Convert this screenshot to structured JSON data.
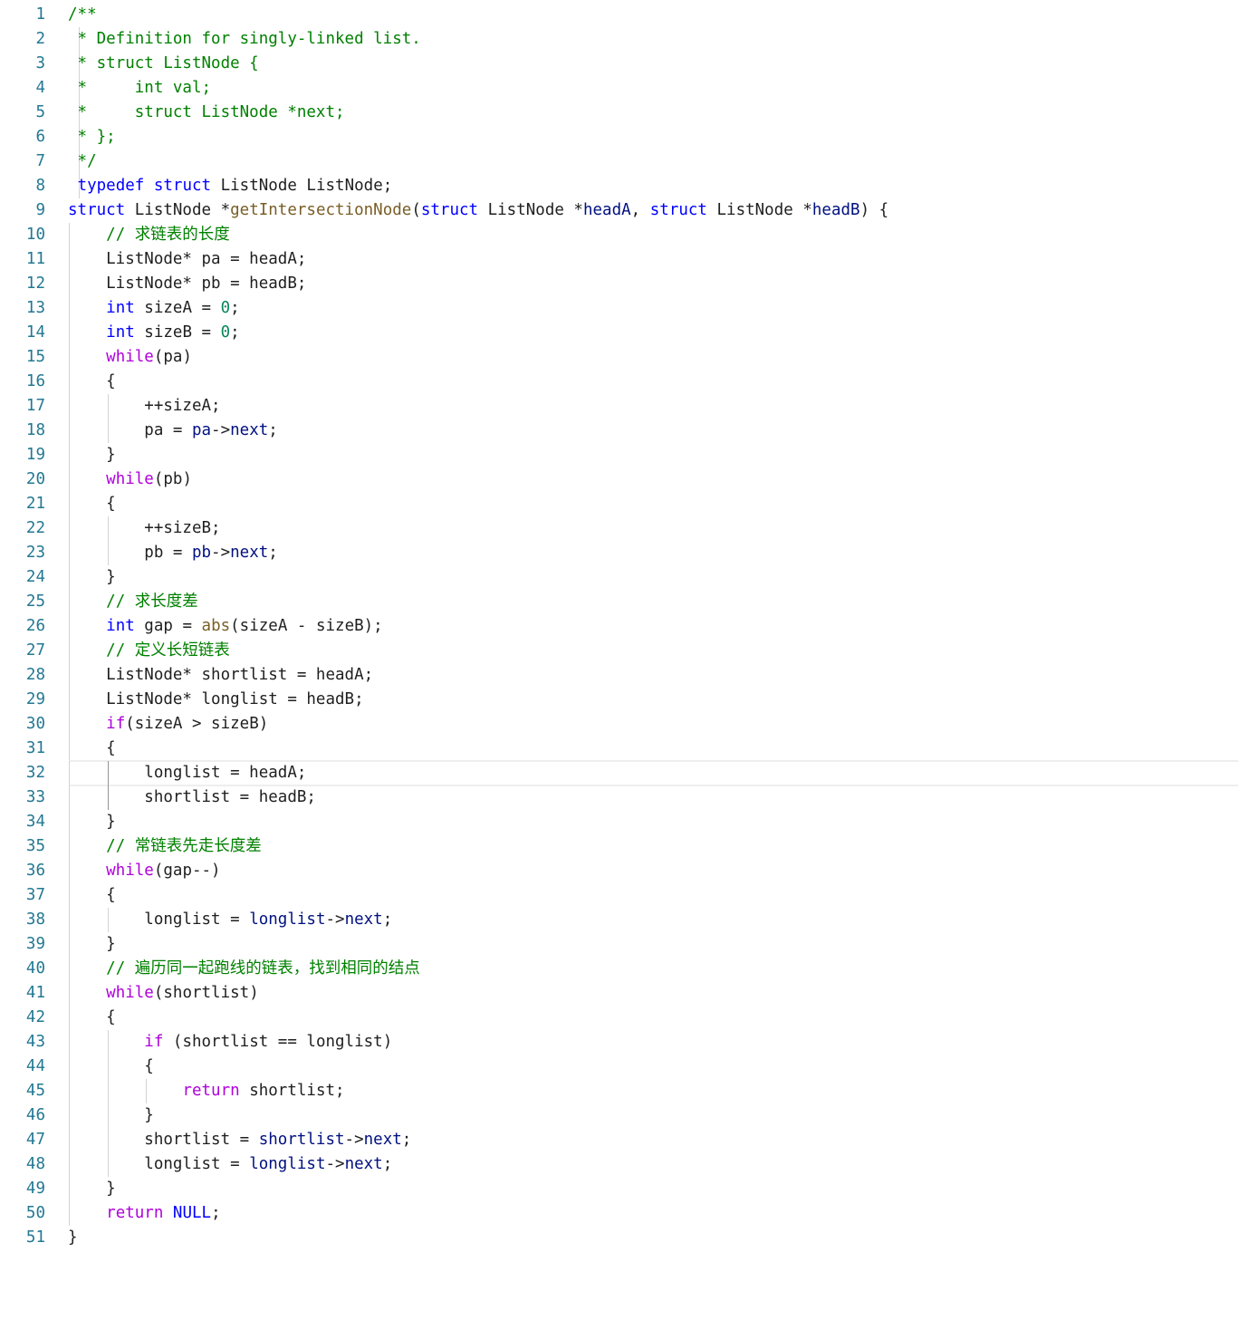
{
  "editor": {
    "language": "c",
    "current_line": 32,
    "lines": [
      {
        "n": "1",
        "tokens": [
          [
            "comment",
            "/**"
          ]
        ]
      },
      {
        "n": "2",
        "tokens": [
          [
            "comment",
            " * Definition for singly-linked list."
          ]
        ]
      },
      {
        "n": "3",
        "tokens": [
          [
            "comment",
            " * struct ListNode {"
          ]
        ]
      },
      {
        "n": "4",
        "tokens": [
          [
            "comment",
            " *     int val;"
          ]
        ]
      },
      {
        "n": "5",
        "tokens": [
          [
            "comment",
            " *     struct ListNode *next;"
          ]
        ]
      },
      {
        "n": "6",
        "tokens": [
          [
            "comment",
            " * };"
          ]
        ]
      },
      {
        "n": "7",
        "tokens": [
          [
            "comment",
            " */"
          ]
        ]
      },
      {
        "n": "8",
        "tokens": [
          [
            "text",
            " "
          ],
          [
            "keyword",
            "typedef"
          ],
          [
            "text",
            " "
          ],
          [
            "keyword",
            "struct"
          ],
          [
            "text",
            " ListNode ListNode;"
          ]
        ]
      },
      {
        "n": "9",
        "tokens": [
          [
            "keyword",
            "struct"
          ],
          [
            "text",
            " ListNode *"
          ],
          [
            "func",
            "getIntersectionNode"
          ],
          [
            "text",
            "("
          ],
          [
            "keyword",
            "struct"
          ],
          [
            "text",
            " ListNode *"
          ],
          [
            "var",
            "headA"
          ],
          [
            "text",
            ", "
          ],
          [
            "keyword",
            "struct"
          ],
          [
            "text",
            " ListNode *"
          ],
          [
            "var",
            "headB"
          ],
          [
            "text",
            ") {"
          ]
        ]
      },
      {
        "n": "10",
        "tokens": [
          [
            "text",
            "    "
          ],
          [
            "comment",
            "// "
          ],
          [
            "comment-cjk",
            "求链表的长度"
          ]
        ]
      },
      {
        "n": "11",
        "tokens": [
          [
            "text",
            "    ListNode* pa = headA;"
          ]
        ]
      },
      {
        "n": "12",
        "tokens": [
          [
            "text",
            "    ListNode* pb = headB;"
          ]
        ]
      },
      {
        "n": "13",
        "tokens": [
          [
            "text",
            "    "
          ],
          [
            "type",
            "int"
          ],
          [
            "text",
            " sizeA = "
          ],
          [
            "number",
            "0"
          ],
          [
            "text",
            ";"
          ]
        ]
      },
      {
        "n": "14",
        "tokens": [
          [
            "text",
            "    "
          ],
          [
            "type",
            "int"
          ],
          [
            "text",
            " sizeB = "
          ],
          [
            "number",
            "0"
          ],
          [
            "text",
            ";"
          ]
        ]
      },
      {
        "n": "15",
        "tokens": [
          [
            "text",
            "    "
          ],
          [
            "control",
            "while"
          ],
          [
            "text",
            "(pa)"
          ]
        ]
      },
      {
        "n": "16",
        "tokens": [
          [
            "text",
            "    {"
          ]
        ]
      },
      {
        "n": "17",
        "tokens": [
          [
            "text",
            "        ++sizeA;"
          ]
        ]
      },
      {
        "n": "18",
        "tokens": [
          [
            "text",
            "        pa = "
          ],
          [
            "var",
            "pa"
          ],
          [
            "text",
            "->"
          ],
          [
            "var",
            "next"
          ],
          [
            "text",
            ";"
          ]
        ]
      },
      {
        "n": "19",
        "tokens": [
          [
            "text",
            "    }"
          ]
        ]
      },
      {
        "n": "20",
        "tokens": [
          [
            "text",
            "    "
          ],
          [
            "control",
            "while"
          ],
          [
            "text",
            "(pb)"
          ]
        ]
      },
      {
        "n": "21",
        "tokens": [
          [
            "text",
            "    {"
          ]
        ]
      },
      {
        "n": "22",
        "tokens": [
          [
            "text",
            "        ++sizeB;"
          ]
        ]
      },
      {
        "n": "23",
        "tokens": [
          [
            "text",
            "        pb = "
          ],
          [
            "var",
            "pb"
          ],
          [
            "text",
            "->"
          ],
          [
            "var",
            "next"
          ],
          [
            "text",
            ";"
          ]
        ]
      },
      {
        "n": "24",
        "tokens": [
          [
            "text",
            "    }"
          ]
        ]
      },
      {
        "n": "25",
        "tokens": [
          [
            "text",
            "    "
          ],
          [
            "comment",
            "// "
          ],
          [
            "comment-cjk",
            "求长度差"
          ]
        ]
      },
      {
        "n": "26",
        "tokens": [
          [
            "text",
            "    "
          ],
          [
            "type",
            "int"
          ],
          [
            "text",
            " gap = "
          ],
          [
            "func",
            "abs"
          ],
          [
            "text",
            "(sizeA - sizeB);"
          ]
        ]
      },
      {
        "n": "27",
        "tokens": [
          [
            "text",
            "    "
          ],
          [
            "comment",
            "// "
          ],
          [
            "comment-cjk",
            "定义长短链表"
          ]
        ]
      },
      {
        "n": "28",
        "tokens": [
          [
            "text",
            "    ListNode* shortlist = headA;"
          ]
        ]
      },
      {
        "n": "29",
        "tokens": [
          [
            "text",
            "    ListNode* longlist = headB;"
          ]
        ]
      },
      {
        "n": "30",
        "tokens": [
          [
            "text",
            "    "
          ],
          [
            "control",
            "if"
          ],
          [
            "text",
            "(sizeA > sizeB)"
          ]
        ]
      },
      {
        "n": "31",
        "tokens": [
          [
            "text",
            "    {"
          ]
        ]
      },
      {
        "n": "32",
        "tokens": [
          [
            "text",
            "        longlist = headA;"
          ]
        ]
      },
      {
        "n": "33",
        "tokens": [
          [
            "text",
            "        shortlist = headB;"
          ]
        ]
      },
      {
        "n": "34",
        "tokens": [
          [
            "text",
            "    }"
          ]
        ]
      },
      {
        "n": "35",
        "tokens": [
          [
            "text",
            "    "
          ],
          [
            "comment",
            "// "
          ],
          [
            "comment-cjk",
            "常链表先走长度差"
          ]
        ]
      },
      {
        "n": "36",
        "tokens": [
          [
            "text",
            "    "
          ],
          [
            "control",
            "while"
          ],
          [
            "text",
            "(gap--)"
          ]
        ]
      },
      {
        "n": "37",
        "tokens": [
          [
            "text",
            "    {"
          ]
        ]
      },
      {
        "n": "38",
        "tokens": [
          [
            "text",
            "        longlist = "
          ],
          [
            "var",
            "longlist"
          ],
          [
            "text",
            "->"
          ],
          [
            "var",
            "next"
          ],
          [
            "text",
            ";"
          ]
        ]
      },
      {
        "n": "39",
        "tokens": [
          [
            "text",
            "    }"
          ]
        ]
      },
      {
        "n": "40",
        "tokens": [
          [
            "text",
            "    "
          ],
          [
            "comment",
            "// "
          ],
          [
            "comment-cjk",
            "遍历同一起跑线的链表，找到相同的结点"
          ]
        ]
      },
      {
        "n": "41",
        "tokens": [
          [
            "text",
            "    "
          ],
          [
            "control",
            "while"
          ],
          [
            "text",
            "(shortlist)"
          ]
        ]
      },
      {
        "n": "42",
        "tokens": [
          [
            "text",
            "    {"
          ]
        ]
      },
      {
        "n": "43",
        "tokens": [
          [
            "text",
            "        "
          ],
          [
            "control",
            "if"
          ],
          [
            "text",
            " (shortlist == longlist)"
          ]
        ]
      },
      {
        "n": "44",
        "tokens": [
          [
            "text",
            "        {"
          ]
        ]
      },
      {
        "n": "45",
        "tokens": [
          [
            "text",
            "            "
          ],
          [
            "control",
            "return"
          ],
          [
            "text",
            " shortlist;"
          ]
        ]
      },
      {
        "n": "46",
        "tokens": [
          [
            "text",
            "        }"
          ]
        ]
      },
      {
        "n": "47",
        "tokens": [
          [
            "text",
            "        shortlist = "
          ],
          [
            "var",
            "shortlist"
          ],
          [
            "text",
            "->"
          ],
          [
            "var",
            "next"
          ],
          [
            "text",
            ";"
          ]
        ]
      },
      {
        "n": "48",
        "tokens": [
          [
            "text",
            "        longlist = "
          ],
          [
            "var",
            "longlist"
          ],
          [
            "text",
            "->"
          ],
          [
            "var",
            "next"
          ],
          [
            "text",
            ";"
          ]
        ]
      },
      {
        "n": "49",
        "tokens": [
          [
            "text",
            "    }"
          ]
        ]
      },
      {
        "n": "50",
        "tokens": [
          [
            "text",
            "    "
          ],
          [
            "control",
            "return"
          ],
          [
            "text",
            " "
          ],
          [
            "const",
            "NULL"
          ],
          [
            "text",
            ";"
          ]
        ]
      },
      {
        "n": "51",
        "tokens": [
          [
            "text",
            "}"
          ]
        ]
      }
    ]
  }
}
